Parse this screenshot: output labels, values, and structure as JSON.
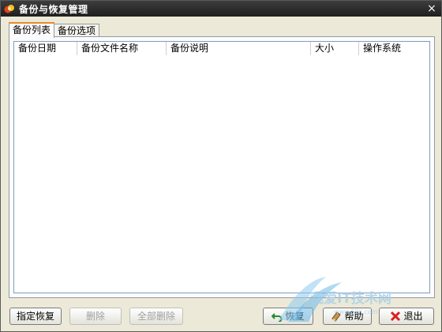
{
  "window": {
    "title": "备份与恢复管理",
    "close_label": "×"
  },
  "tabs": [
    {
      "label": "备份列表",
      "active": true
    },
    {
      "label": "备份选项",
      "active": false
    }
  ],
  "table": {
    "columns": [
      "备份日期",
      "备份文件名称",
      "备份说明",
      "大小",
      "操作系统"
    ],
    "rows": []
  },
  "buttons": {
    "restore_specified": "指定恢复",
    "delete": "删除",
    "delete_all": "全部删除",
    "restore": "恢复",
    "help": "帮助",
    "exit": "退出"
  },
  "colors": {
    "titlebar": "#2b2b2b",
    "tab_accent": "#e68b2c",
    "window_bg": "#ece9d8"
  }
}
